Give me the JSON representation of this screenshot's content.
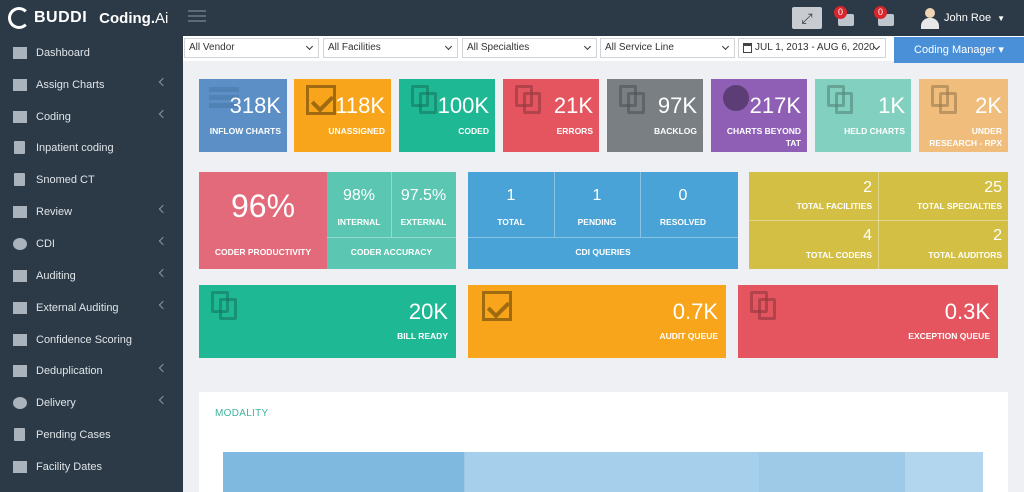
{
  "brand": {
    "buddi": "BUDDI",
    "coding": "Coding.",
    "ai": "Ai"
  },
  "header": {
    "expand_icon": "expand-icon",
    "notifications": [
      {
        "count": "0",
        "icon": "inbox-icon"
      },
      {
        "count": "0",
        "icon": "edit-icon"
      }
    ],
    "user_name": "John Roe"
  },
  "sidebar": {
    "items": [
      {
        "label": "Dashboard",
        "icon": "dashboard-icon",
        "chevron": false
      },
      {
        "label": "Assign Charts",
        "icon": "list-icon",
        "chevron": true
      },
      {
        "label": "Coding",
        "icon": "check-square-icon",
        "chevron": true
      },
      {
        "label": "Inpatient coding",
        "icon": "document-icon",
        "chevron": false
      },
      {
        "label": "Snomed CT",
        "icon": "document-icon",
        "chevron": false
      },
      {
        "label": "Review",
        "icon": "edit-icon",
        "chevron": true
      },
      {
        "label": "CDI",
        "icon": "alert-circle-icon",
        "chevron": true
      },
      {
        "label": "Auditing",
        "icon": "thumbs-up-icon",
        "chevron": true
      },
      {
        "label": "External Auditing",
        "icon": "thumbs-up-icon",
        "chevron": true
      },
      {
        "label": "Confidence Scoring",
        "icon": "thumbs-up-icon",
        "chevron": false
      },
      {
        "label": "Deduplication",
        "icon": "thumbs-up-icon",
        "chevron": true
      },
      {
        "label": "Delivery",
        "icon": "check-circle-icon",
        "chevron": true
      },
      {
        "label": "Pending Cases",
        "icon": "document-icon",
        "chevron": false
      },
      {
        "label": "Facility Dates",
        "icon": "bar-chart-icon",
        "chevron": false
      }
    ]
  },
  "filters": {
    "vendor": "All Vendor",
    "facilities": "All Facilities",
    "specialties": "All Specialties",
    "service_line": "All Service Line",
    "date_range": "JUL 1, 2013 - AUG 6, 2020",
    "role_button": "Coding Manager"
  },
  "tiles": [
    {
      "value": "318K",
      "label": "INFLOW CHARTS",
      "color": "#5b8fc5"
    },
    {
      "value": "118K",
      "label": "UNASSIGNED",
      "color": "#f8a51b"
    },
    {
      "value": "100K",
      "label": "CODED",
      "color": "#1fb894"
    },
    {
      "value": "21K",
      "label": "ERRORS",
      "color": "#e4555f"
    },
    {
      "value": "97K",
      "label": "BACKLOG",
      "color": "#7a7f83"
    },
    {
      "value": "217K",
      "label": "CHARTS BEYOND TAT",
      "color": "#8e5fb5"
    },
    {
      "value": "1K",
      "label": "HELD CHARTS",
      "color": "#82d0bf"
    },
    {
      "value": "2K",
      "label": "UNDER RESEARCH - RPX",
      "color": "#f0bd7c"
    }
  ],
  "productivity": {
    "value": "96%",
    "label": "CODER PRODUCTIVITY",
    "color": "#e26a7a"
  },
  "accuracy": {
    "internal_value": "98%",
    "internal_label": "INTERNAL",
    "external_value": "97.5%",
    "external_label": "EXTERNAL",
    "label": "CODER ACCURACY",
    "color": "#5bc6b2"
  },
  "cdi": {
    "total_value": "1",
    "total_label": "TOTAL",
    "pending_value": "1",
    "pending_label": "PENDING",
    "resolved_value": "0",
    "resolved_label": "RESOLVED",
    "label": "CDI QUERIES",
    "color": "#4aa3d6"
  },
  "totals": {
    "facilities_value": "2",
    "facilities_label": "TOTAL FACILITIES",
    "specialties_value": "25",
    "specialties_label": "TOTAL SPECIALTIES",
    "coders_value": "4",
    "coders_label": "TOTAL CODERS",
    "auditors_value": "2",
    "auditors_label": "TOTAL AUDITORS",
    "color": "#d4bf45"
  },
  "queues": [
    {
      "value": "20K",
      "label": "BILL READY",
      "color": "#1fb894"
    },
    {
      "value": "0.7K",
      "label": "AUDIT QUEUE",
      "color": "#f8a51b"
    },
    {
      "value": "0.3K",
      "label": "EXCEPTION QUEUE",
      "color": "#e4555f"
    }
  ],
  "modality": {
    "title": "MODALITY"
  }
}
